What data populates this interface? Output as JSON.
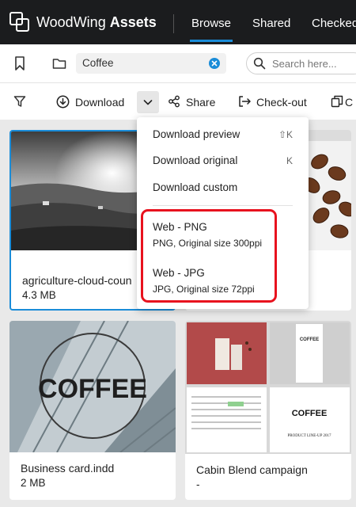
{
  "app": {
    "brand_regular": "WoodWing",
    "brand_bold": "Assets"
  },
  "nav": {
    "tabs": [
      {
        "label": "Browse",
        "active": true
      },
      {
        "label": "Shared"
      },
      {
        "label": "Checked"
      }
    ]
  },
  "search_row": {
    "folder_value": "Coffee",
    "search_placeholder": "Search here..."
  },
  "toolbar": {
    "download_label": "Download",
    "share_label": "Share",
    "checkout_label": "Check-out"
  },
  "cards": [
    {
      "title": "agriculture-cloud-coun",
      "meta": "4.3 MB",
      "selected": true
    },
    {
      "title": "Business card.indd",
      "meta": "2 MB"
    },
    {
      "title": "Cabin Blend campaign",
      "meta": "-"
    }
  ],
  "thumbs": {
    "coffee_logo": "COFFEE",
    "mini_coffee": "COFFEE",
    "mini_caption": "PRODUCT LINE-UP 2017"
  },
  "dropdown": {
    "items": [
      {
        "label": "Download preview",
        "shortcut": "⇧K"
      },
      {
        "label": "Download original",
        "shortcut": "K"
      },
      {
        "label": "Download custom"
      }
    ],
    "presets": [
      {
        "label": "Web - PNG",
        "sub": "PNG, Original size 300ppi"
      },
      {
        "label": "Web - JPG",
        "sub": "JPG, Original size 72ppi"
      }
    ]
  },
  "colors": {
    "accent": "#1a8cd8",
    "highlight": "#e8121e",
    "topbar": "#1b1c1e"
  }
}
